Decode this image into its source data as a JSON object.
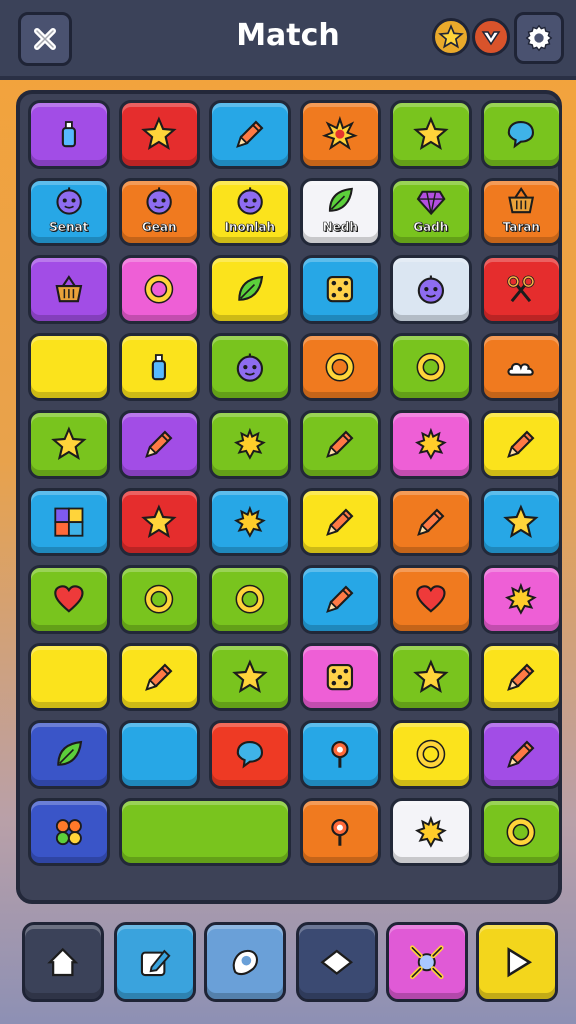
{
  "header": {
    "title": "Match",
    "close_icon": "close-icon",
    "star_icon": "star-icon",
    "rank_icon": "rank-chevron-icon",
    "settings_icon": "gear-icon"
  },
  "colors": {
    "purple": "#a24de6",
    "red": "#e52d2d",
    "blue": "#27a7e6",
    "orange": "#f07a1f",
    "green": "#79c41e",
    "yellow": "#fbe31c",
    "pink": "#ee5fd6",
    "navy": "#3a55c8",
    "white": "#f4f4f8",
    "lightblue": "#dbe6f2",
    "redorange": "#ee3a24"
  },
  "board": {
    "tiles": [
      {
        "color": "purple",
        "icon": "bottle"
      },
      {
        "color": "red",
        "icon": "star"
      },
      {
        "color": "blue",
        "icon": "pencil"
      },
      {
        "color": "orange",
        "icon": "burst"
      },
      {
        "color": "green",
        "icon": "star"
      },
      {
        "color": "green",
        "icon": "speech-bubble"
      },
      {
        "color": "blue",
        "icon": "monster",
        "label": "Senat"
      },
      {
        "color": "orange",
        "icon": "monster",
        "label": "Gean"
      },
      {
        "color": "yellow",
        "icon": "monster",
        "label": "Inonlah"
      },
      {
        "color": "white",
        "icon": "leaf",
        "label": "Nedh"
      },
      {
        "color": "green",
        "icon": "gem",
        "label": "Gadh"
      },
      {
        "color": "orange",
        "icon": "basket",
        "label": "Taran"
      },
      {
        "color": "purple",
        "icon": "basket"
      },
      {
        "color": "pink",
        "icon": "ring"
      },
      {
        "color": "yellow",
        "icon": "leaf"
      },
      {
        "color": "blue",
        "icon": "dice"
      },
      {
        "color": "lightblue",
        "icon": "monster"
      },
      {
        "color": "red",
        "icon": "scissors"
      },
      {
        "color": "yellow",
        "icon": "none"
      },
      {
        "color": "yellow",
        "icon": "bottle"
      },
      {
        "color": "green",
        "icon": "monster"
      },
      {
        "color": "orange",
        "icon": "ring"
      },
      {
        "color": "green",
        "icon": "ring"
      },
      {
        "color": "orange",
        "icon": "cloud"
      },
      {
        "color": "green",
        "icon": "star"
      },
      {
        "color": "purple",
        "icon": "pencil"
      },
      {
        "color": "green",
        "icon": "sun"
      },
      {
        "color": "green",
        "icon": "pencil"
      },
      {
        "color": "pink",
        "icon": "sun"
      },
      {
        "color": "yellow",
        "icon": "pencil"
      },
      {
        "color": "blue",
        "icon": "blocks"
      },
      {
        "color": "red",
        "icon": "star"
      },
      {
        "color": "blue",
        "icon": "sun"
      },
      {
        "color": "yellow",
        "icon": "pencil"
      },
      {
        "color": "orange",
        "icon": "pencil"
      },
      {
        "color": "blue",
        "icon": "star"
      },
      {
        "color": "green",
        "icon": "heart"
      },
      {
        "color": "green",
        "icon": "ring"
      },
      {
        "color": "green",
        "icon": "ring"
      },
      {
        "color": "blue",
        "icon": "pencil"
      },
      {
        "color": "orange",
        "icon": "heart"
      },
      {
        "color": "pink",
        "icon": "sun"
      },
      {
        "color": "yellow",
        "icon": "none"
      },
      {
        "color": "yellow",
        "icon": "pencil"
      },
      {
        "color": "green",
        "icon": "star"
      },
      {
        "color": "pink",
        "icon": "dice"
      },
      {
        "color": "green",
        "icon": "star"
      },
      {
        "color": "yellow",
        "icon": "pencil"
      },
      {
        "color": "navy",
        "icon": "leaf"
      },
      {
        "color": "blue",
        "icon": "none"
      },
      {
        "color": "redorange",
        "icon": "speech-bubble"
      },
      {
        "color": "blue",
        "icon": "pin"
      },
      {
        "color": "yellow",
        "icon": "ring"
      },
      {
        "color": "purple",
        "icon": "pencil"
      },
      {
        "color": "navy",
        "icon": "flower"
      },
      {
        "color": "green",
        "icon": "none",
        "span": 2
      },
      {
        "color": "orange",
        "icon": "pin"
      },
      {
        "color": "white",
        "icon": "sun"
      },
      {
        "color": "green",
        "icon": "ring"
      }
    ]
  },
  "nav": {
    "buttons": [
      {
        "name": "home",
        "icon": "home-icon",
        "color": "#3b4259"
      },
      {
        "name": "edit",
        "icon": "edit-icon",
        "color": "#3aa3dd"
      },
      {
        "name": "shape",
        "icon": "shape-icon",
        "color": "#6aa0d8"
      },
      {
        "name": "diamond",
        "icon": "diamond-icon",
        "color": "#3b4a72"
      },
      {
        "name": "shuffle",
        "icon": "shuffle-icon",
        "color": "#e05ad6"
      },
      {
        "name": "play",
        "icon": "play-icon",
        "color": "#f3d61c"
      }
    ]
  }
}
